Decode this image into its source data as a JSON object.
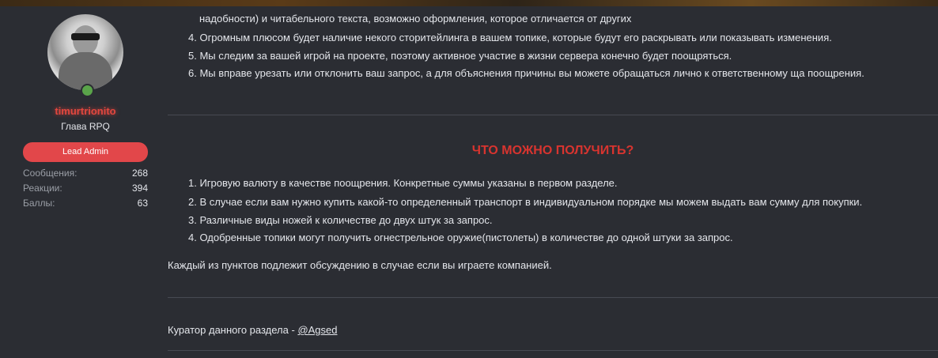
{
  "user": {
    "username": "timurtrionito",
    "title": "Глава RPQ",
    "banner": "Lead Admin",
    "stats": [
      {
        "label": "Сообщения:",
        "value": "268"
      },
      {
        "label": "Реакции:",
        "value": "394"
      },
      {
        "label": "Баллы:",
        "value": "63"
      }
    ]
  },
  "post": {
    "top_list": [
      "надобности) и читабельного текста, возможно оформления, которое отличается от других",
      "4. Огромным плюсом будет наличие некого сторитейлинга в вашем топике, которые будут его раскрывать или показывать изменения.",
      "5. Мы следим за вашей игрой на проекте, поэтому активное участие в жизни сервера конечно будет поощряться.",
      "6. Мы вправе урезать или отклонить ваш запрос, а для объяснения причины вы можете обращаться лично к ответственному ща поощрения."
    ],
    "section_title": "ЧТО МОЖНО ПОЛУЧИТЬ?",
    "rewards": [
      "1. Игровую валюту в качестве поощрения. Конкретные суммы указаны в первом разделе.",
      "2. В случае если вам нужно купить какой-то определенный транспорт в индивидуальном порядке мы можем выдать вам сумму для покупки.",
      "3. Различные виды ножей к количестве до двух штук за запрос.",
      "4. Одобренные топики могут получить огнестрельное оружие(пистолеты) в количестве до одной штуки за запрос."
    ],
    "note": "Каждый из пунктов подлежит обсуждению в случае если вы играете компанией.",
    "curator_label": "Куратор данного раздела - ",
    "curator_mention": "@Agsed"
  },
  "colors": {
    "background": "#2b2d33",
    "username": "#e2473f",
    "banner": "#e2474a",
    "section_title": "#d8342f",
    "online": "#5aa44a"
  }
}
